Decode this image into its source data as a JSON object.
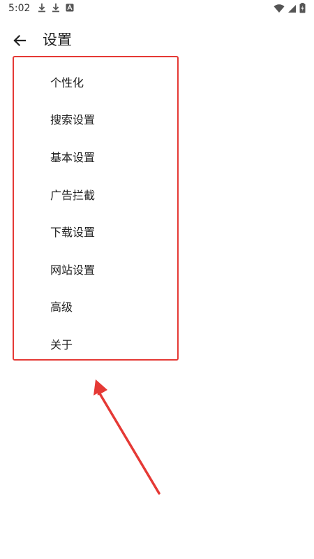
{
  "status_bar": {
    "time": "5:02",
    "left_icons": [
      "download-icon",
      "download-icon",
      "notification-icon"
    ],
    "right_icons": [
      "wifi-icon",
      "signal-icon",
      "battery-icon"
    ]
  },
  "header": {
    "back_icon": "arrow-left-icon",
    "title": "设置"
  },
  "settings": {
    "items": [
      {
        "label": "个性化"
      },
      {
        "label": "搜索设置"
      },
      {
        "label": "基本设置"
      },
      {
        "label": "广告拦截"
      },
      {
        "label": "下载设置"
      },
      {
        "label": "网站设置"
      },
      {
        "label": "高级"
      },
      {
        "label": "关于"
      }
    ]
  },
  "annotation": {
    "highlight_color": "#e53935",
    "arrow_color": "#e53935"
  }
}
